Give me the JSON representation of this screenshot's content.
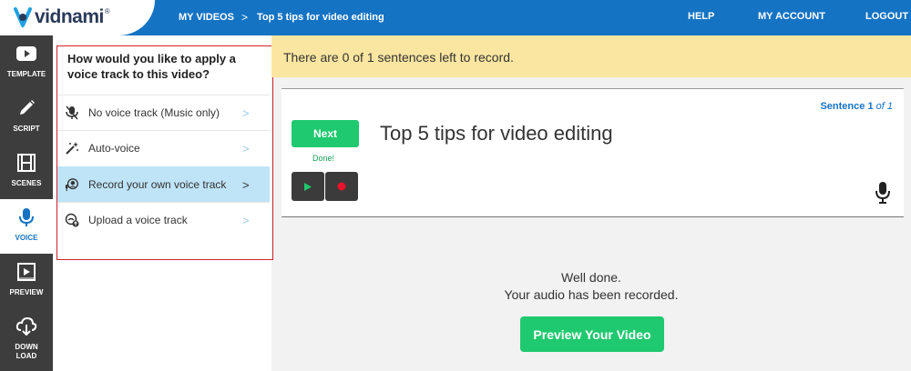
{
  "app": {
    "brand": "vidnami",
    "brand_mark": "®"
  },
  "breadcrumb": {
    "my_videos": "MY VIDEOS",
    "separator": ">",
    "current": "Top 5 tips for video editing"
  },
  "topnav": {
    "help": "HELP",
    "account": "MY ACCOUNT",
    "logout": "LOGOUT"
  },
  "rail": [
    {
      "label": "TEMPLATE",
      "icon": "youtube-play-icon"
    },
    {
      "label": "SCRIPT",
      "icon": "pencil-icon"
    },
    {
      "label": "SCENES",
      "icon": "film-icon"
    },
    {
      "label": "VOICE",
      "icon": "microphone-icon",
      "active": true
    },
    {
      "label": "PREVIEW",
      "icon": "play-screen-icon"
    },
    {
      "label_line1": "DOWN",
      "label_line2": "LOAD",
      "icon": "cloud-download-icon"
    }
  ],
  "voice_panel": {
    "title": "How would you like to apply a voice track to this video?",
    "options": [
      {
        "label": "No voice track (Music only)",
        "icon": "muted-microphone-icon"
      },
      {
        "label": "Auto-voice",
        "icon": "magic-wand-icon"
      },
      {
        "label": "Record your own voice track",
        "icon": "record-voice-icon",
        "selected": true
      },
      {
        "label": "Upload a voice track",
        "icon": "upload-voice-icon"
      }
    ]
  },
  "banner": {
    "text": "There are 0 of 1 sentences left to record."
  },
  "sentence": {
    "counter_label": "Sentence",
    "current": "1",
    "of_total": "of 1",
    "next_label": "Next",
    "done_label": "Done!",
    "text": "Top 5 tips for video editing"
  },
  "result": {
    "line1": "Well done.",
    "line2": "Your audio has been recorded.",
    "preview_label": "Preview Your Video"
  },
  "colors": {
    "accent": "#1573c4",
    "green": "#1fc96f",
    "banner": "#fbe6a1",
    "selected": "#bfe3f7",
    "highlight_border": "#d2232a"
  }
}
